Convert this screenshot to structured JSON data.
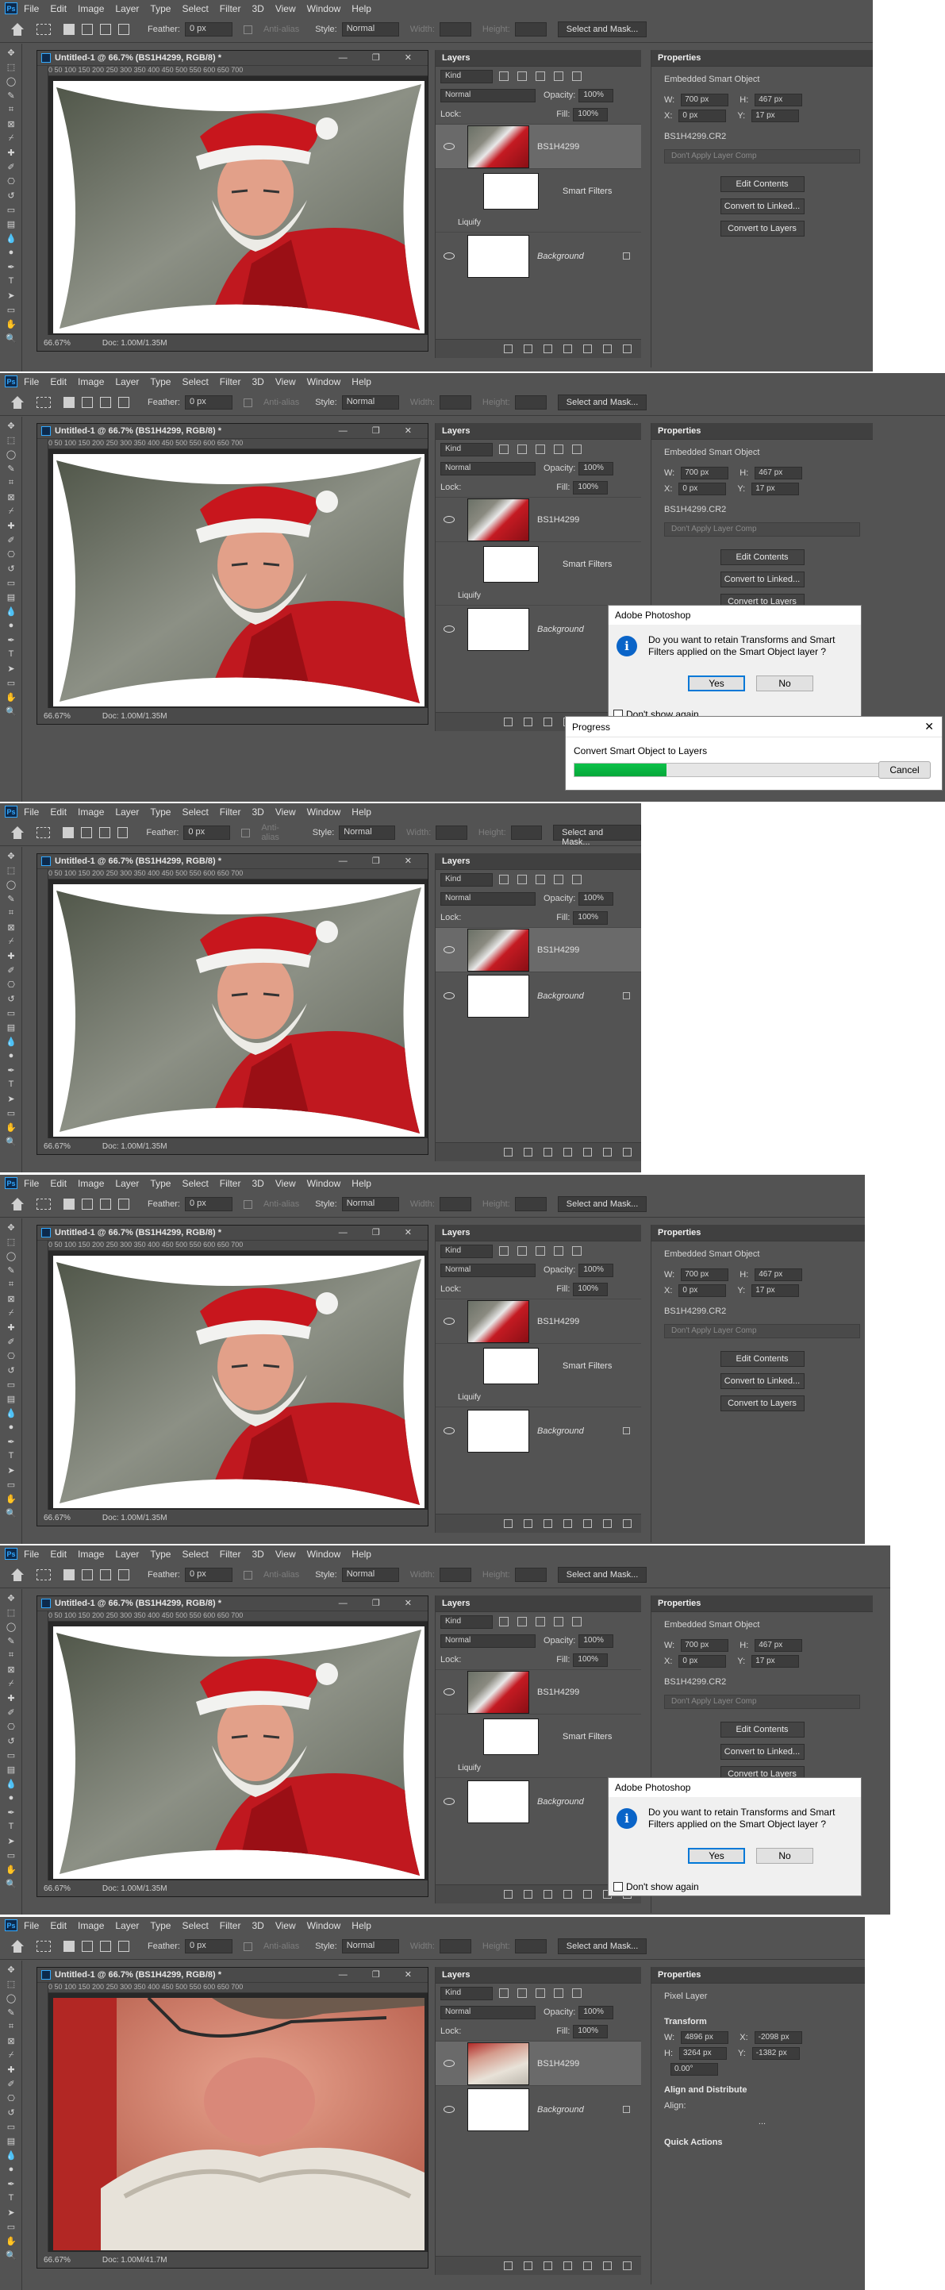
{
  "menu": [
    "File",
    "Edit",
    "Image",
    "Layer",
    "Type",
    "Select",
    "Filter",
    "3D",
    "View",
    "Window",
    "Help"
  ],
  "options": {
    "feather_label": "Feather:",
    "feather_value": "0 px",
    "antialias_label": "Anti-alias",
    "style_label": "Style:",
    "style_value": "Normal",
    "width_label": "Width:",
    "height_label": "Height:",
    "select_mask": "Select and Mask..."
  },
  "doc": {
    "title_a": "Untitled-1 @ 66.7% (BS1H4299, RGB/8) *",
    "title_b": "Untitled-1 @ 66.7% (BS1H4299, RGB/8) *",
    "ruler": "0   50  100  150  200  250  300  350  400  450  500  550  600  650  700",
    "zoom": "66.67%",
    "size": "Doc: 1.00M/1.35M",
    "size_last": "Doc: 1.00M/41.7M"
  },
  "layers": {
    "tab": "Layers",
    "kind": "Kind",
    "blend": "Normal",
    "opacity_label": "Opacity:",
    "opacity": "100%",
    "lock_label": "Lock:",
    "fill_label": "Fill:",
    "fill": "100%",
    "layer_name": "BS1H4299",
    "smart_filters": "Smart Filters",
    "liquify": "Liquify",
    "background": "Background"
  },
  "props": {
    "tab": "Properties",
    "embedded": "Embedded Smart Object",
    "pixel_layer": "Pixel Layer",
    "w_label": "W:",
    "w": "700 px",
    "h_label": "H:",
    "h": "467 px",
    "x_label": "X:",
    "x": "0 px",
    "y_label": "Y:",
    "y": "17 px",
    "file": "BS1H4299.CR2",
    "layer_comp": "Don't Apply Layer Comp",
    "edit": "Edit Contents",
    "linked": "Convert to Linked...",
    "to_layers": "Convert to Layers",
    "transform": "Transform",
    "tw": "4896 px",
    "th": "3264 px",
    "tx": "-2098 px",
    "ty": "-1382 px",
    "angle": "0.00°",
    "align": "Align and Distribute",
    "align_label": "Align:",
    "quick": "Quick Actions",
    "more": "..."
  },
  "dialog": {
    "title": "Adobe Photoshop",
    "message": "Do you want to retain Transforms and Smart Filters applied on the Smart Object layer ?",
    "yes": "Yes",
    "no": "No",
    "dont_show": "Don't show again",
    "info": "i"
  },
  "progress": {
    "title": "Progress",
    "message": "Convert Smart Object to Layers",
    "cancel": "Cancel",
    "percent": 0.3
  }
}
